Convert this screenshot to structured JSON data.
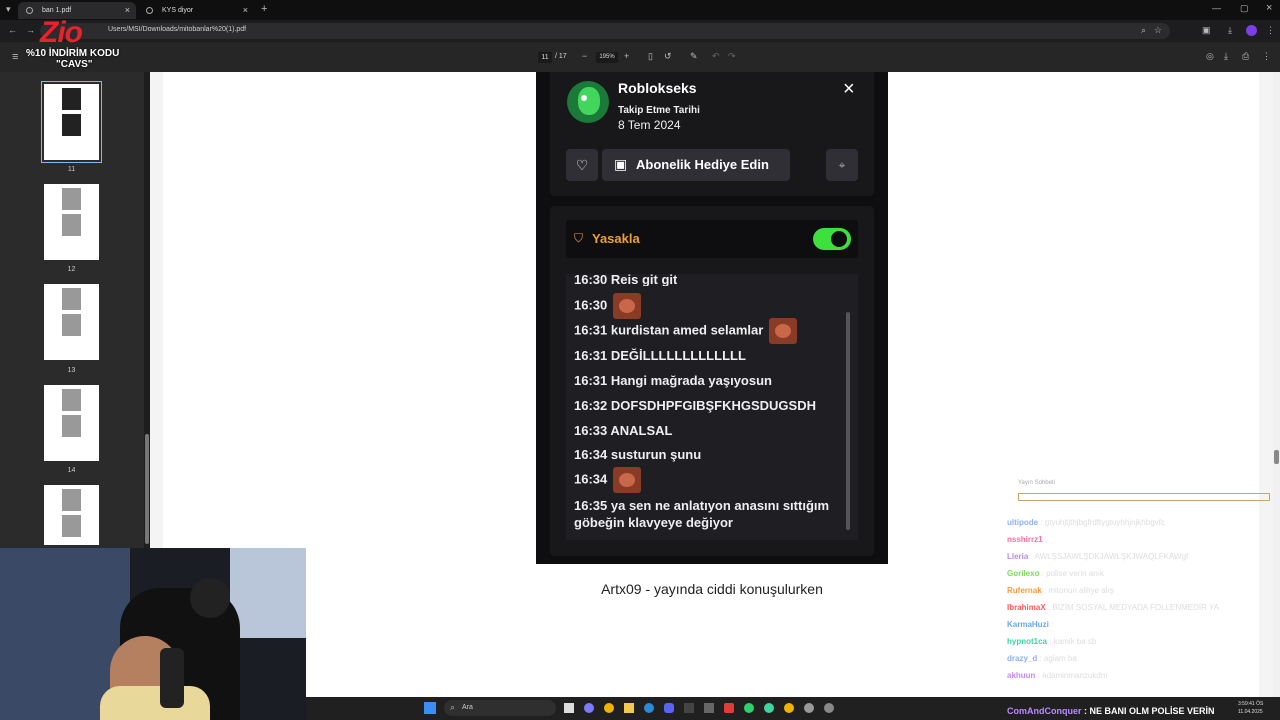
{
  "browser": {
    "tabs": [
      {
        "title": "ban 1.pdf",
        "active": true
      },
      {
        "title": "KYS diyor",
        "active": false
      }
    ],
    "new_tab": "+",
    "url": "Users/MSI/Downloads/mitobanlar%20(1).pdf"
  },
  "overlay": {
    "logo": "Zio",
    "promo_line1": "%10 İNDİRİM KODU",
    "promo_line2": "\"CAVS\""
  },
  "pdf_toolbar": {
    "page_current": "11",
    "page_total": "/ 17",
    "zoom": "195%",
    "minus": "−",
    "plus": "+"
  },
  "sidebar": {
    "pages": [
      "11",
      "12",
      "13",
      "14",
      ""
    ]
  },
  "profile_card": {
    "username": "Roblokseks",
    "follow_label": "Takip Etme Tarihi",
    "follow_date": "8 Tem 2024",
    "gift_button": "Abonelik Hediye Edin",
    "ban_label": "Yasakla",
    "accent": "#3ee03e"
  },
  "chat_log": [
    {
      "time": "16:30",
      "text": "Reis git git",
      "emote": false
    },
    {
      "time": "16:30",
      "text": "",
      "emote": true
    },
    {
      "time": "16:31",
      "text": "kurdistan amed selamlar",
      "emote": true
    },
    {
      "time": "16:31",
      "text": "DEĞİLLLLLLLLLLLLL",
      "emote": false
    },
    {
      "time": "16:31",
      "text": "Hangi mağrada yaşıyosun",
      "emote": false
    },
    {
      "time": "16:32",
      "text": "DOFSDHPFGIBŞFKHGSDUGSDH",
      "emote": false
    },
    {
      "time": "16:33",
      "text": "ANALSAL",
      "emote": false
    },
    {
      "time": "16:34",
      "text": "susturun şunu",
      "emote": false
    },
    {
      "time": "16:34",
      "text": "",
      "emote": true
    },
    {
      "time": "16:35",
      "text": "ya sen ne anlatıyon anasını sıttığım",
      "text2": "göbeğin klavyeye değiyor",
      "emote": false
    }
  ],
  "caption": "Artx09 - yayında ciddi konuşulurken",
  "stream_chat": [
    {
      "user": "ultipode",
      "msg": ": gtyuhjtjthjbgfrdftygtuyhhjnjkhbgvfc",
      "color": "#8fb0ff"
    },
    {
      "user": "nsshirrz1",
      "msg": ":",
      "color": "#ff6fa8"
    },
    {
      "user": "Lleria",
      "msg": ": AWLŞSJAWLŞDKJAWLŞKJWAQLFKAWgf",
      "color": "#b38bff"
    },
    {
      "user": "Gorilexo",
      "msg": ": polise verin anık",
      "color": "#7cdc5a"
    },
    {
      "user": "Rufernak",
      "msg": ": mitonun aliliye alış",
      "color": "#ff9a3c"
    },
    {
      "user": "IbrahimaX",
      "msg": ": BİZİM SOSYAL MEDYADA FOLLENMEDİR YA",
      "color": "#ff5c5c"
    },
    {
      "user": "KarmaHuzi",
      "msg": ":",
      "color": "#6aa8ff"
    },
    {
      "user": "hypnot1ca",
      "msg": ": kamik ba sb",
      "color": "#3ed6a0"
    },
    {
      "user": "drazy_d",
      "msg": ": aglam ba",
      "color": "#8fb0ff"
    },
    {
      "user": "akhuun",
      "msg": ": adaminmanzukdm",
      "color": "#c48bff"
    },
    {
      "user": "ComAndConquer",
      "msg": ": NE BANI OLM POLİSE VERİN",
      "color": "#b98bff"
    }
  ],
  "stream_header": "Yayın Sohbeti",
  "taskbar": {
    "search": "Ara",
    "time": "3:59:41 ÖS",
    "date": "11.04.2025"
  }
}
